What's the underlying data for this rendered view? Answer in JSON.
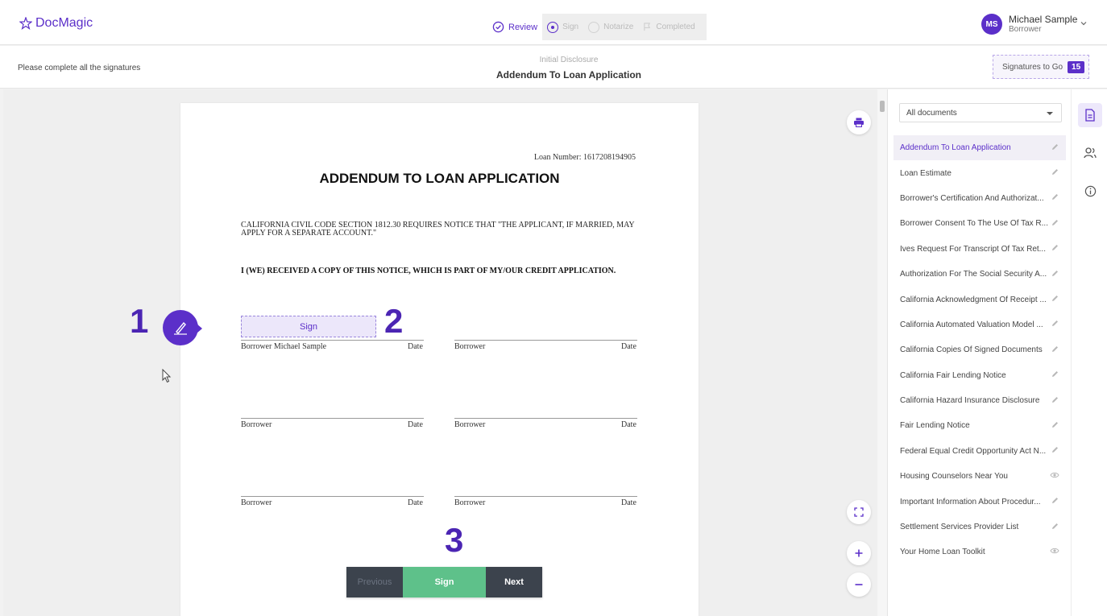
{
  "header": {
    "logo_text": "DocMagic",
    "steps": [
      {
        "label": "Review",
        "state": "done"
      },
      {
        "label": "Sign",
        "state": "current"
      },
      {
        "label": "Notarize",
        "state": "pending"
      },
      {
        "label": "Completed",
        "state": "pending"
      }
    ],
    "user": {
      "initials": "MS",
      "name": "Michael Sample",
      "role": "Borrower"
    }
  },
  "subheader": {
    "instruction": "Please complete all the signatures",
    "doc_category": "Initial Disclosure",
    "doc_title": "Addendum To Loan Application",
    "signatures_label": "Signatures to Go",
    "signatures_count": "15"
  },
  "page": {
    "loan_number": "Loan Number: 1617208194905",
    "heading": "ADDENDUM TO LOAN APPLICATION",
    "notice": "CALIFORNIA CIVIL CODE SECTION 1812.30 REQUIRES NOTICE THAT \"THE APPLICANT, IF MARRIED, MAY APPLY FOR A SEPARATE ACCOUNT.\"",
    "acknowledgement": "I (WE) RECEIVED A COPY OF THIS NOTICE, WHICH IS PART OF MY/OUR CREDIT APPLICATION.",
    "sign_field_label": "Sign",
    "signature_rows": [
      {
        "left_label": "Borrower Michael Sample",
        "left_date": "Date",
        "right_label": "Borrower",
        "right_date": "Date"
      },
      {
        "left_label": "Borrower",
        "left_date": "Date",
        "right_label": "Borrower",
        "right_date": "Date"
      },
      {
        "left_label": "Borrower",
        "left_date": "Date",
        "right_label": "Borrower",
        "right_date": "Date"
      }
    ]
  },
  "callouts": {
    "one": "1",
    "two": "2",
    "three": "3"
  },
  "navigation": {
    "previous": "Previous",
    "sign": "Sign",
    "next": "Next"
  },
  "doc_panel": {
    "filter_value": "All documents",
    "documents": [
      {
        "name": "Addendum To Loan Application",
        "icon": "pencil-icon",
        "active": true
      },
      {
        "name": "Loan Estimate",
        "icon": "pencil-icon"
      },
      {
        "name": "Borrower's Certification And Authorizat...",
        "icon": "pencil-icon"
      },
      {
        "name": "Borrower Consent To The Use Of Tax R...",
        "icon": "pencil-icon"
      },
      {
        "name": "Ives Request For Transcript Of Tax Ret...",
        "icon": "pencil-icon"
      },
      {
        "name": "Authorization For The Social Security A...",
        "icon": "pencil-icon"
      },
      {
        "name": "California Acknowledgment Of Receipt ...",
        "icon": "pencil-icon"
      },
      {
        "name": "California Automated Valuation Model ...",
        "icon": "pencil-icon"
      },
      {
        "name": "California Copies Of Signed Documents",
        "icon": "pencil-icon"
      },
      {
        "name": "California Fair Lending Notice",
        "icon": "pencil-icon"
      },
      {
        "name": "California Hazard Insurance Disclosure",
        "icon": "pencil-icon"
      },
      {
        "name": "Fair Lending Notice",
        "icon": "pencil-icon"
      },
      {
        "name": "Federal Equal Credit Opportunity Act N...",
        "icon": "pencil-icon"
      },
      {
        "name": "Housing Counselors Near You",
        "icon": "eye-icon"
      },
      {
        "name": "Important Information About Procedur...",
        "icon": "pencil-icon"
      },
      {
        "name": "Settlement Services Provider List",
        "icon": "pencil-icon"
      },
      {
        "name": "Your Home Loan Toolkit",
        "icon": "eye-icon"
      }
    ]
  },
  "colors": {
    "brand": "#5b2fc9",
    "sign_green": "#5ec18a",
    "nav_dark": "#3c434d"
  }
}
